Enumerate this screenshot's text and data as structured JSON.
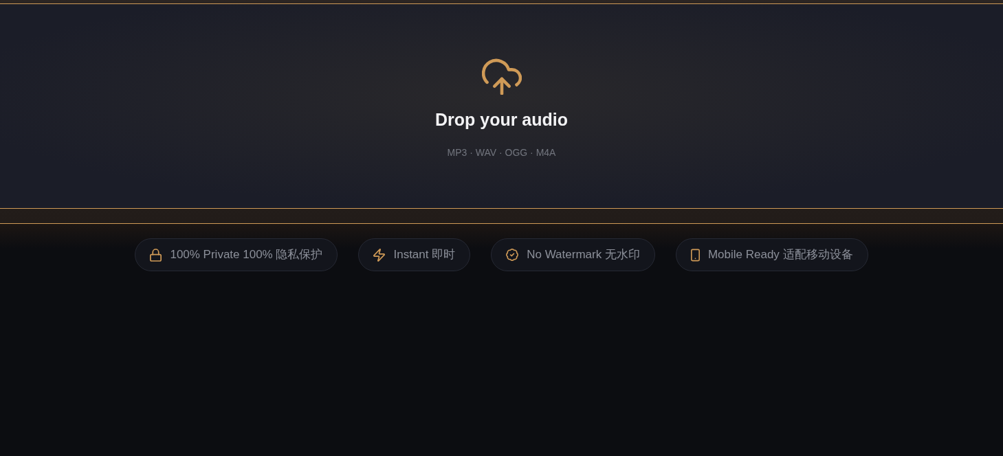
{
  "upload": {
    "title": "Drop your audio",
    "formats": "MP3 · WAV · OGG · M4A"
  },
  "features": [
    {
      "kind": "lock",
      "label": "100% Private 100% 隐私保护"
    },
    {
      "kind": "bolt",
      "label": "Instant 即时"
    },
    {
      "kind": "badge",
      "label": "No Watermark 无水印"
    },
    {
      "kind": "phone",
      "label": "Mobile Ready 适配移动设备"
    }
  ]
}
